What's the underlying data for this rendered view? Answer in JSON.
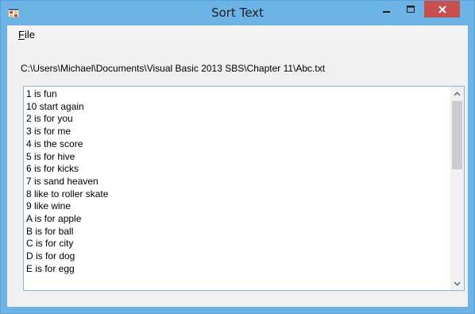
{
  "window": {
    "title": "Sort Text",
    "titlebar_color": "#6cb3e6",
    "close_color": "#c7504f"
  },
  "menu": {
    "file_mnemonic": "F",
    "file_rest": "ile"
  },
  "path_label": "C:\\Users\\Michael\\Documents\\Visual Basic 2013 SBS\\Chapter 11\\Abc.txt",
  "textbox": {
    "lines": [
      "1 is fun",
      "10 start again",
      "2 is for you",
      "3 is for me",
      "4 is the score",
      "5 is for hive",
      "6 is for kicks",
      "7 is sand heaven",
      "8 like to roller skate",
      "9 like wine",
      "A is for apple",
      "B is for ball",
      "C is for city",
      "D is for dog",
      "E is for egg"
    ]
  },
  "icons": {
    "app": "app-icon",
    "minimize": "minimize-icon",
    "maximize": "maximize-icon",
    "close": "close-icon",
    "scroll_up": "chevron-up-icon",
    "scroll_down": "chevron-down-icon"
  }
}
